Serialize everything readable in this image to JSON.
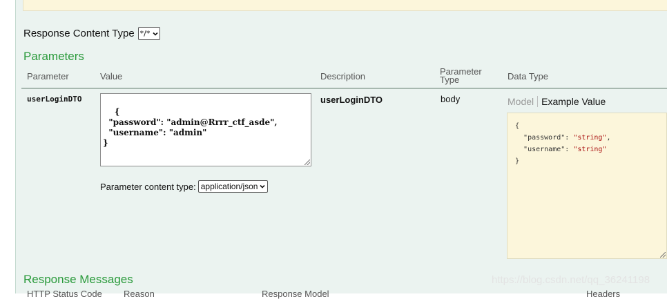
{
  "response_content_type": {
    "label": "Response Content Type",
    "selected": "*/*"
  },
  "parameters": {
    "title": "Parameters",
    "headers": {
      "parameter": "Parameter",
      "value": "Value",
      "description": "Description",
      "parameter_type_line1": "Parameter",
      "parameter_type_line2": "Type",
      "data_type": "Data Type"
    },
    "row": {
      "name": "userLoginDTO",
      "value_text": "{\n  \"password\": \"admin@Rrrr_ctf_asde\",\n  \"username\": \"admin\"\n}",
      "description": "userLoginDTO",
      "param_type": "body",
      "content_type_label": "Parameter content type:",
      "content_type_selected": "application/json",
      "tabs": {
        "model": "Model",
        "example": "Example Value"
      },
      "example": {
        "open": "{",
        "password_key": "\"password\"",
        "password_val": "\"string\"",
        "username_key": "\"username\"",
        "username_val": "\"string\"",
        "close": "}"
      }
    }
  },
  "response_messages": {
    "title": "Response Messages",
    "partial_headers": [
      "HTTP Status Code",
      "Reason",
      "Response Model",
      "Headers"
    ]
  },
  "watermark": "https://blog.csdn.net/qq_36241198",
  "colors": {
    "section_title": "#2a9a3b",
    "panel_bg": "#ebf3f0",
    "example_bg": "#fcf6db"
  }
}
